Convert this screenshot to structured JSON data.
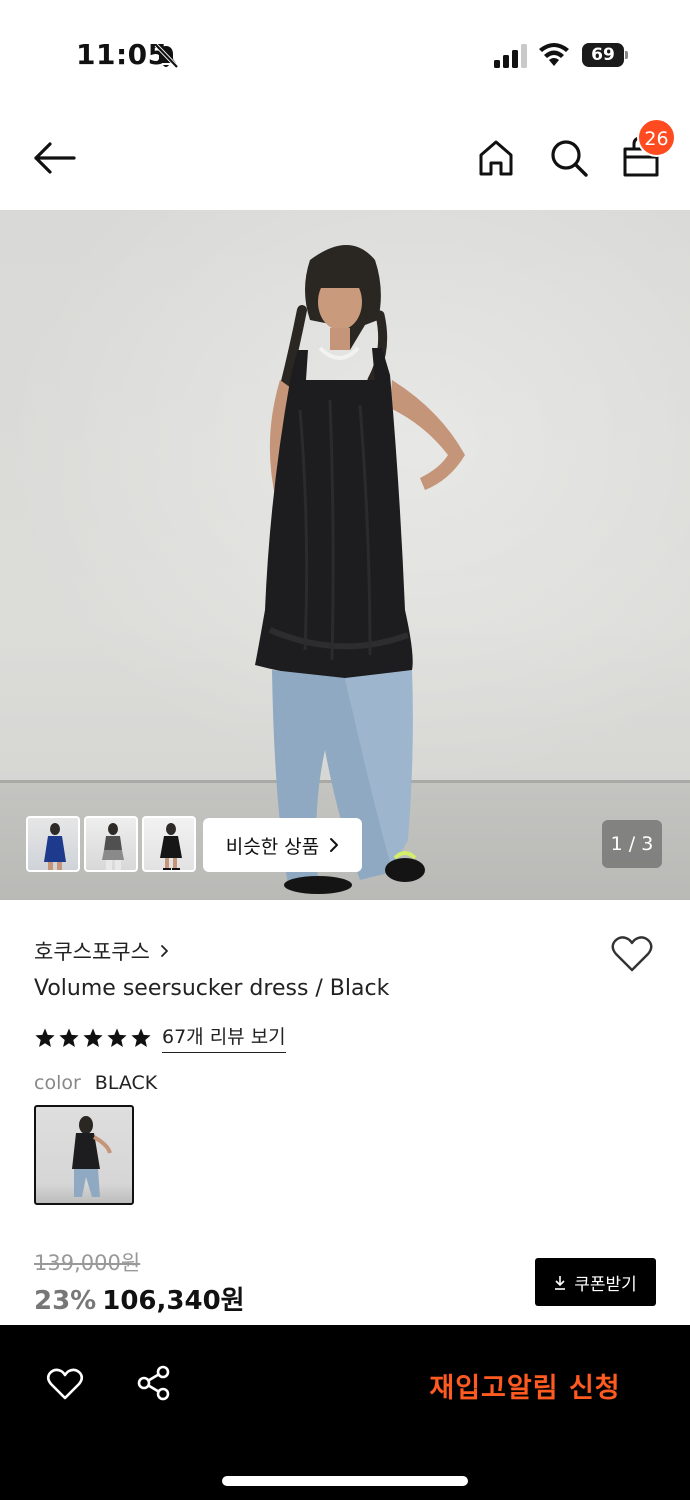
{
  "status_bar": {
    "time": "11:05",
    "battery": "69"
  },
  "nav": {
    "cart_count": "26"
  },
  "gallery": {
    "similar_label": "비슷한 상품",
    "page_indicator": "1 / 3"
  },
  "product": {
    "brand": "호쿠스포쿠스",
    "title": "Volume seersucker dress / Black",
    "rating_stars": 5,
    "review_link": "67개 리뷰 보기",
    "color_label": "color",
    "color_value": "BLACK",
    "original_price": "139,000원",
    "discount": "23%",
    "sale_price": "106,340원",
    "coupon_label": "쿠폰받기"
  },
  "bottom_bar": {
    "restock_label": "재입고알림 신청"
  },
  "colors": {
    "accent": "#ff4b1f",
    "restock": "#ff5a1f"
  }
}
